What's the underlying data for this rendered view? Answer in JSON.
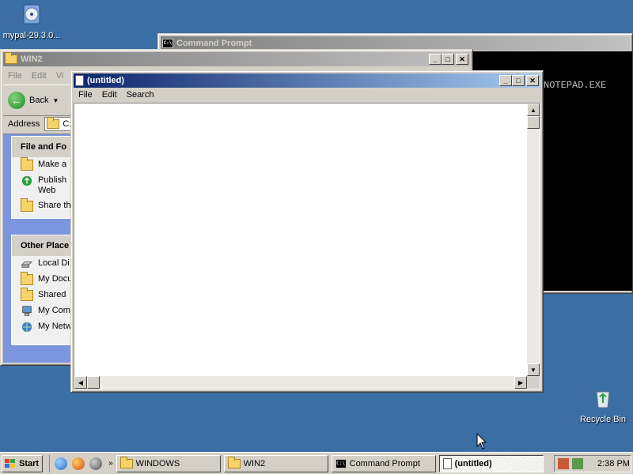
{
  "desktop": {
    "icons": [
      {
        "label": "mypal-29.3.0..."
      },
      {
        "label": "Recycle Bin"
      }
    ]
  },
  "cmd": {
    "title": "Command Prompt",
    "output": "NOTEPAD.EXE"
  },
  "explorer": {
    "title": "WIN2",
    "menu": [
      "File",
      "Edit",
      "Vi"
    ],
    "back_label": "Back",
    "address_label": "Address",
    "address_value": "C:\\",
    "file_panel": {
      "title": "File and Fo",
      "items": [
        "Make a",
        "Publish",
        "Web",
        "Share th"
      ]
    },
    "places_panel": {
      "title": "Other Place",
      "items": [
        "Local Di",
        "My Docu",
        "Shared",
        "My Com",
        "My Netw"
      ]
    }
  },
  "notepad": {
    "title": "(untitled)",
    "menu": [
      "File",
      "Edit",
      "Search"
    ]
  },
  "taskbar": {
    "start_label": "Start",
    "chevron": "»",
    "tasks": [
      "WINDOWS",
      "WIN2",
      "Command Prompt",
      "(untitled)"
    ],
    "clock": "2:38 PM"
  }
}
